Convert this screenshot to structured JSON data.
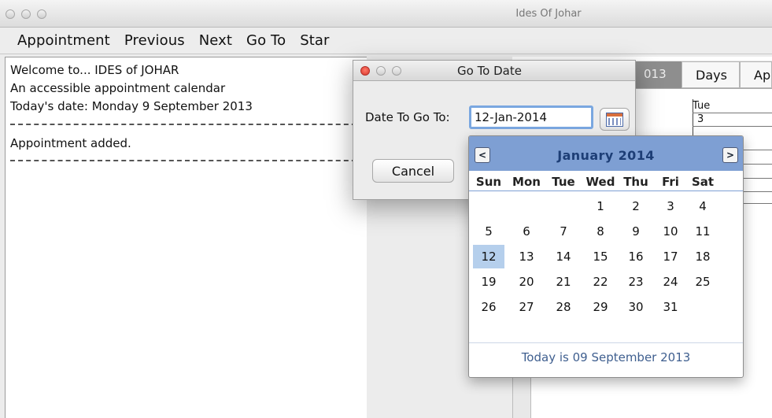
{
  "window": {
    "title": "Ides Of Johar"
  },
  "menu": [
    "Appointment",
    "Previous",
    "Next",
    "Go To",
    "Star"
  ],
  "log": {
    "lines": [
      "Welcome to... IDES of JOHAR",
      "An accessible appointment calendar",
      "Today's date:  Monday 9 September 2013",
      "Appointment added."
    ]
  },
  "background_calendar": {
    "tabs": [
      "013",
      "Days",
      "Ap"
    ],
    "column_header": "Tue",
    "first_date": "3"
  },
  "dialog": {
    "title": "Go To Date",
    "label": "Date To Go To:",
    "date_value": "12-Jan-2014",
    "cancel_label": "Cancel"
  },
  "picker": {
    "prev_label": "<",
    "next_label": ">",
    "month_title": "January 2014",
    "weekdays": [
      "Sun",
      "Mon",
      "Tue",
      "Wed",
      "Thu",
      "Fri",
      "Sat"
    ],
    "weeks": [
      [
        "",
        "",
        "",
        "1",
        "2",
        "3",
        "4"
      ],
      [
        "5",
        "6",
        "7",
        "8",
        "9",
        "10",
        "11"
      ],
      [
        "12",
        "13",
        "14",
        "15",
        "16",
        "17",
        "18"
      ],
      [
        "19",
        "20",
        "21",
        "22",
        "23",
        "24",
        "25"
      ],
      [
        "26",
        "27",
        "28",
        "29",
        "30",
        "31",
        ""
      ]
    ],
    "selected_day": "12",
    "today_text": "Today is  09 September 2013"
  },
  "colors": {
    "picker_header": "#7e9fd3",
    "selected_day": "#b5cfec",
    "close_button": "#d8342a"
  }
}
